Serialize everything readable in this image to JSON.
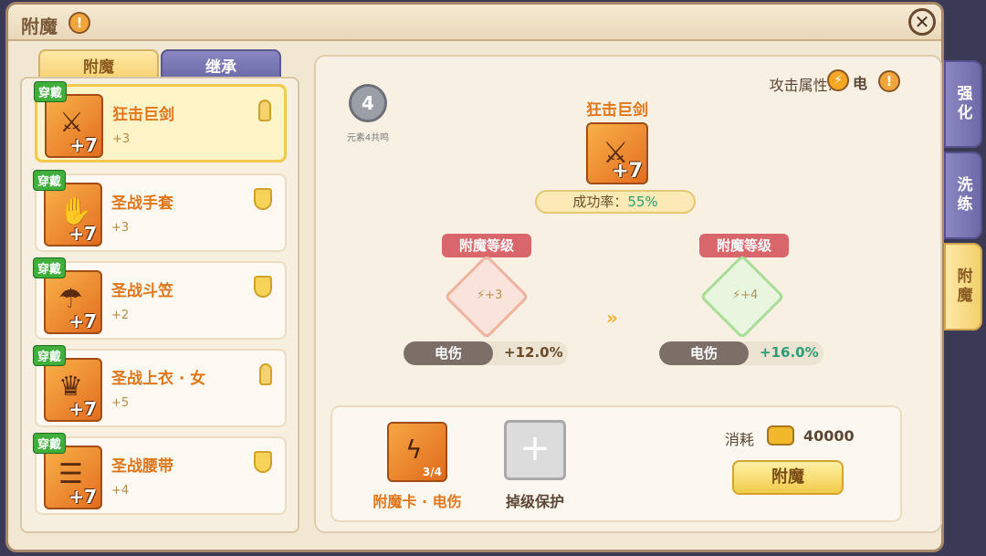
{
  "window": {
    "title": "附魔",
    "close": "✕",
    "info": "!"
  },
  "tabs": [
    {
      "label": "附魔",
      "active": true
    },
    {
      "label": "继承",
      "active": false
    }
  ],
  "items": [
    {
      "wear": "穿戴",
      "name": "狂击巨剑",
      "enchant": "+3",
      "plus": "+7",
      "slot_icon": "pin-icon",
      "selected": true
    },
    {
      "wear": "穿戴",
      "name": "圣战手套",
      "enchant": "+3",
      "plus": "+7",
      "slot_icon": "shield-icon",
      "selected": false
    },
    {
      "wear": "穿戴",
      "name": "圣战斗笠",
      "enchant": "+2",
      "plus": "+7",
      "slot_icon": "shield-icon",
      "selected": false
    },
    {
      "wear": "穿戴",
      "name": "圣战上衣 · 女",
      "enchant": "+5",
      "plus": "+7",
      "slot_icon": "pin-icon",
      "selected": false
    },
    {
      "wear": "穿戴",
      "name": "圣战腰带",
      "enchant": "+4",
      "plus": "+7",
      "slot_icon": "shield-icon",
      "selected": false
    }
  ],
  "attack": {
    "label": "攻击属性:",
    "element": "电",
    "badge": "⚡",
    "info": "!"
  },
  "medal": {
    "level": "4",
    "caption": "元素4共鸣"
  },
  "center": {
    "name": "狂击巨剑",
    "plus": "+7",
    "rate_label": "成功率：",
    "rate_value": "55%"
  },
  "levels": {
    "label_left": "附魔等级",
    "label_right": "附魔等级",
    "current": "+3",
    "next": "+4",
    "arrows": "»"
  },
  "stats": {
    "left": {
      "name": "电伤",
      "value": "+12.0%"
    },
    "right": {
      "name": "电伤",
      "value": "+16.0%"
    }
  },
  "bottom": {
    "card_label": "附魔卡 · 电伤",
    "card_count": "3/4",
    "protect_label": "掉级保护",
    "protect_symbol": "+",
    "cost_label": "消耗",
    "cost_value": "40000",
    "button": "附魔"
  },
  "side_tabs": [
    "强化",
    "洗练",
    "附魔"
  ],
  "colors": {
    "accent": "#e0761c",
    "green": "#2e9e78",
    "panel": "#f1e7d3"
  }
}
